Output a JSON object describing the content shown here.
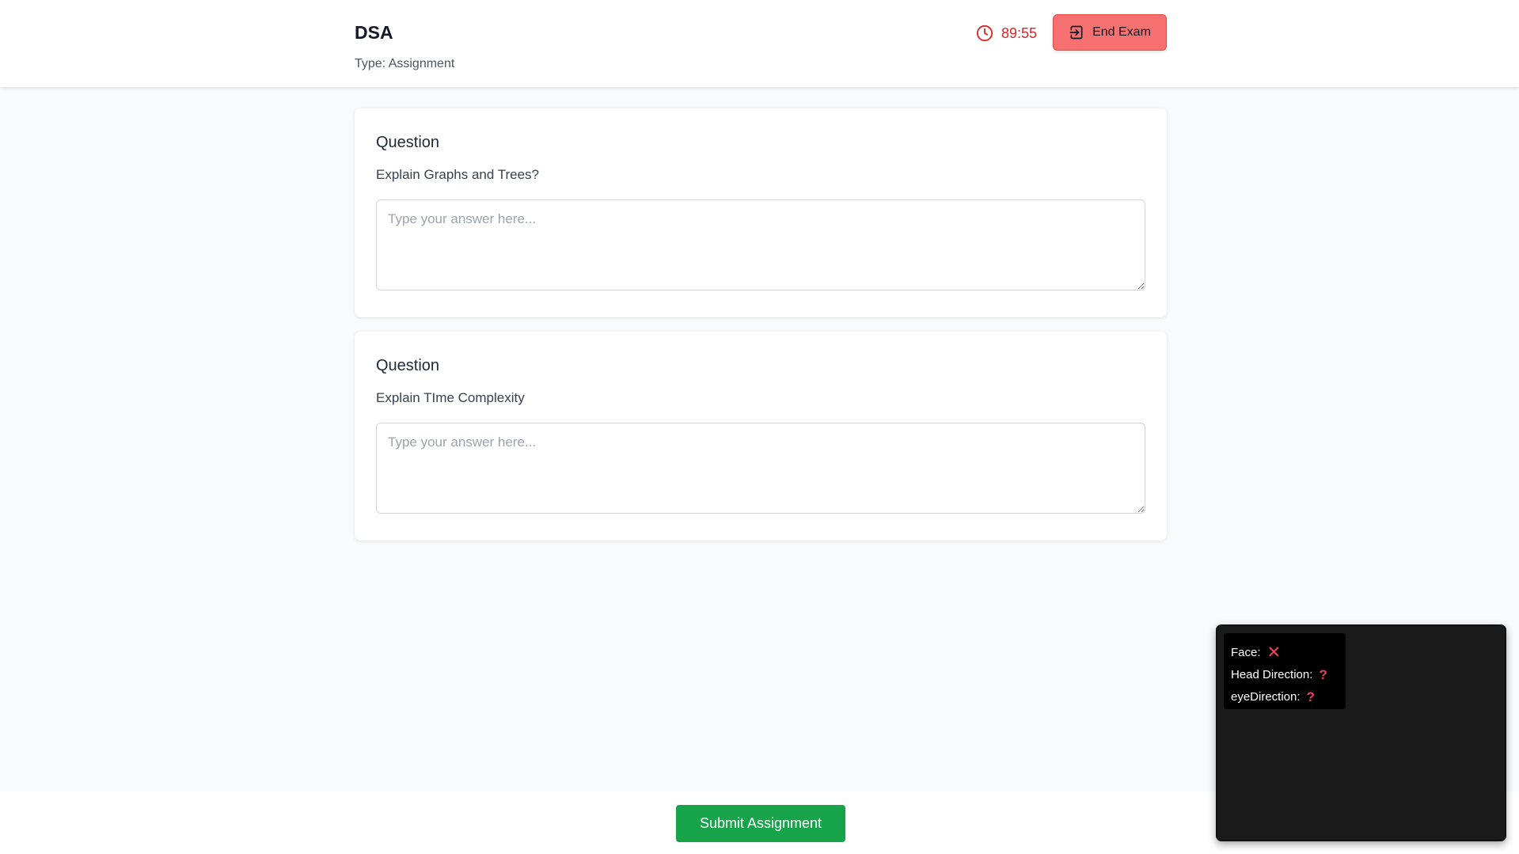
{
  "header": {
    "title": "DSA",
    "type_label": "Type: Assignment",
    "timer": "89:55",
    "end_button_label": "End Exam"
  },
  "questions": [
    {
      "heading": "Question",
      "text": "Explain Graphs and Trees?",
      "answer": "",
      "placeholder": "Type your answer here..."
    },
    {
      "heading": "Question",
      "text": "Explain TIme Complexity",
      "answer": "",
      "placeholder": "Type your answer here..."
    }
  ],
  "footer": {
    "submit_label": "Submit Assignment"
  },
  "proctor": {
    "face_label": "Face:",
    "face_status": "✕",
    "head_label": "Head Direction:",
    "head_status": "?",
    "eye_label": "eyeDirection:",
    "eye_status": "?"
  },
  "colors": {
    "accent_danger": "#dc2626",
    "end_button_bg": "#f87171",
    "submit_bg": "#16a34a",
    "status_icon": "#f43f5e"
  }
}
